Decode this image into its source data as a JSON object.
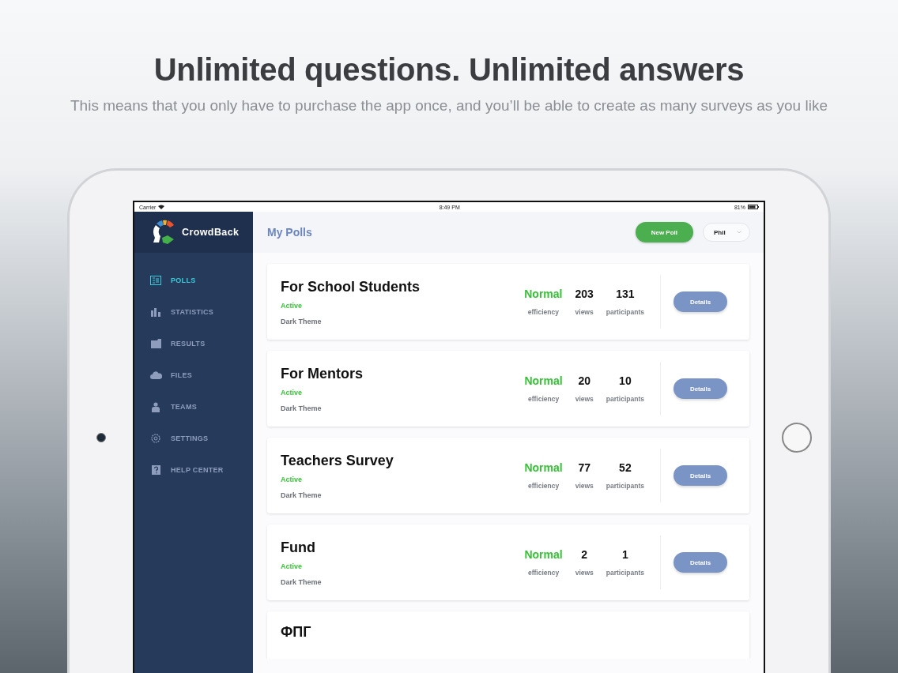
{
  "promo": {
    "headline": "Unlimited questions. Unlimited answers",
    "subtitle": "This means that you only have to purchase the app once, and you’ll be able to create as many surveys as you like"
  },
  "status_bar": {
    "carrier": "Carrier",
    "time": "8:49 PM",
    "battery": "81%"
  },
  "app": {
    "name": "CrowdBack"
  },
  "sidebar": {
    "items": [
      {
        "label": "POLLS",
        "selected": true
      },
      {
        "label": "STATISTICS",
        "selected": false
      },
      {
        "label": "RESULTS",
        "selected": false
      },
      {
        "label": "FILES",
        "selected": false
      },
      {
        "label": "TEAMS",
        "selected": false
      },
      {
        "label": "SETTINGS",
        "selected": false
      },
      {
        "label": "HELP CENTER",
        "selected": false
      }
    ]
  },
  "header": {
    "title": "My Polls",
    "new_button": "New Poll",
    "user": "Phil"
  },
  "polls": [
    {
      "title": "For School Students",
      "status": "Active",
      "theme": "Dark Theme",
      "efficiency": "Normal",
      "efficiency_label": "efficiency",
      "views": "203",
      "views_label": "views",
      "participants": "131",
      "participants_label": "participants",
      "button": "Details"
    },
    {
      "title": "For Mentors",
      "status": "Active",
      "theme": "Dark Theme",
      "efficiency": "Normal",
      "efficiency_label": "efficiency",
      "views": "20",
      "views_label": "views",
      "participants": "10",
      "participants_label": "participants",
      "button": "Details"
    },
    {
      "title": "Teachers Survey",
      "status": "Active",
      "theme": "Dark Theme",
      "efficiency": "Normal",
      "efficiency_label": "efficiency",
      "views": "77",
      "views_label": "views",
      "participants": "52",
      "participants_label": "participants",
      "button": "Details"
    },
    {
      "title": "Fund",
      "status": "Active",
      "theme": "Dark Theme",
      "efficiency": "Normal",
      "efficiency_label": "efficiency",
      "views": "2",
      "views_label": "views",
      "participants": "1",
      "participants_label": "participants",
      "button": "Details"
    },
    {
      "title": "ФПГ"
    }
  ]
}
